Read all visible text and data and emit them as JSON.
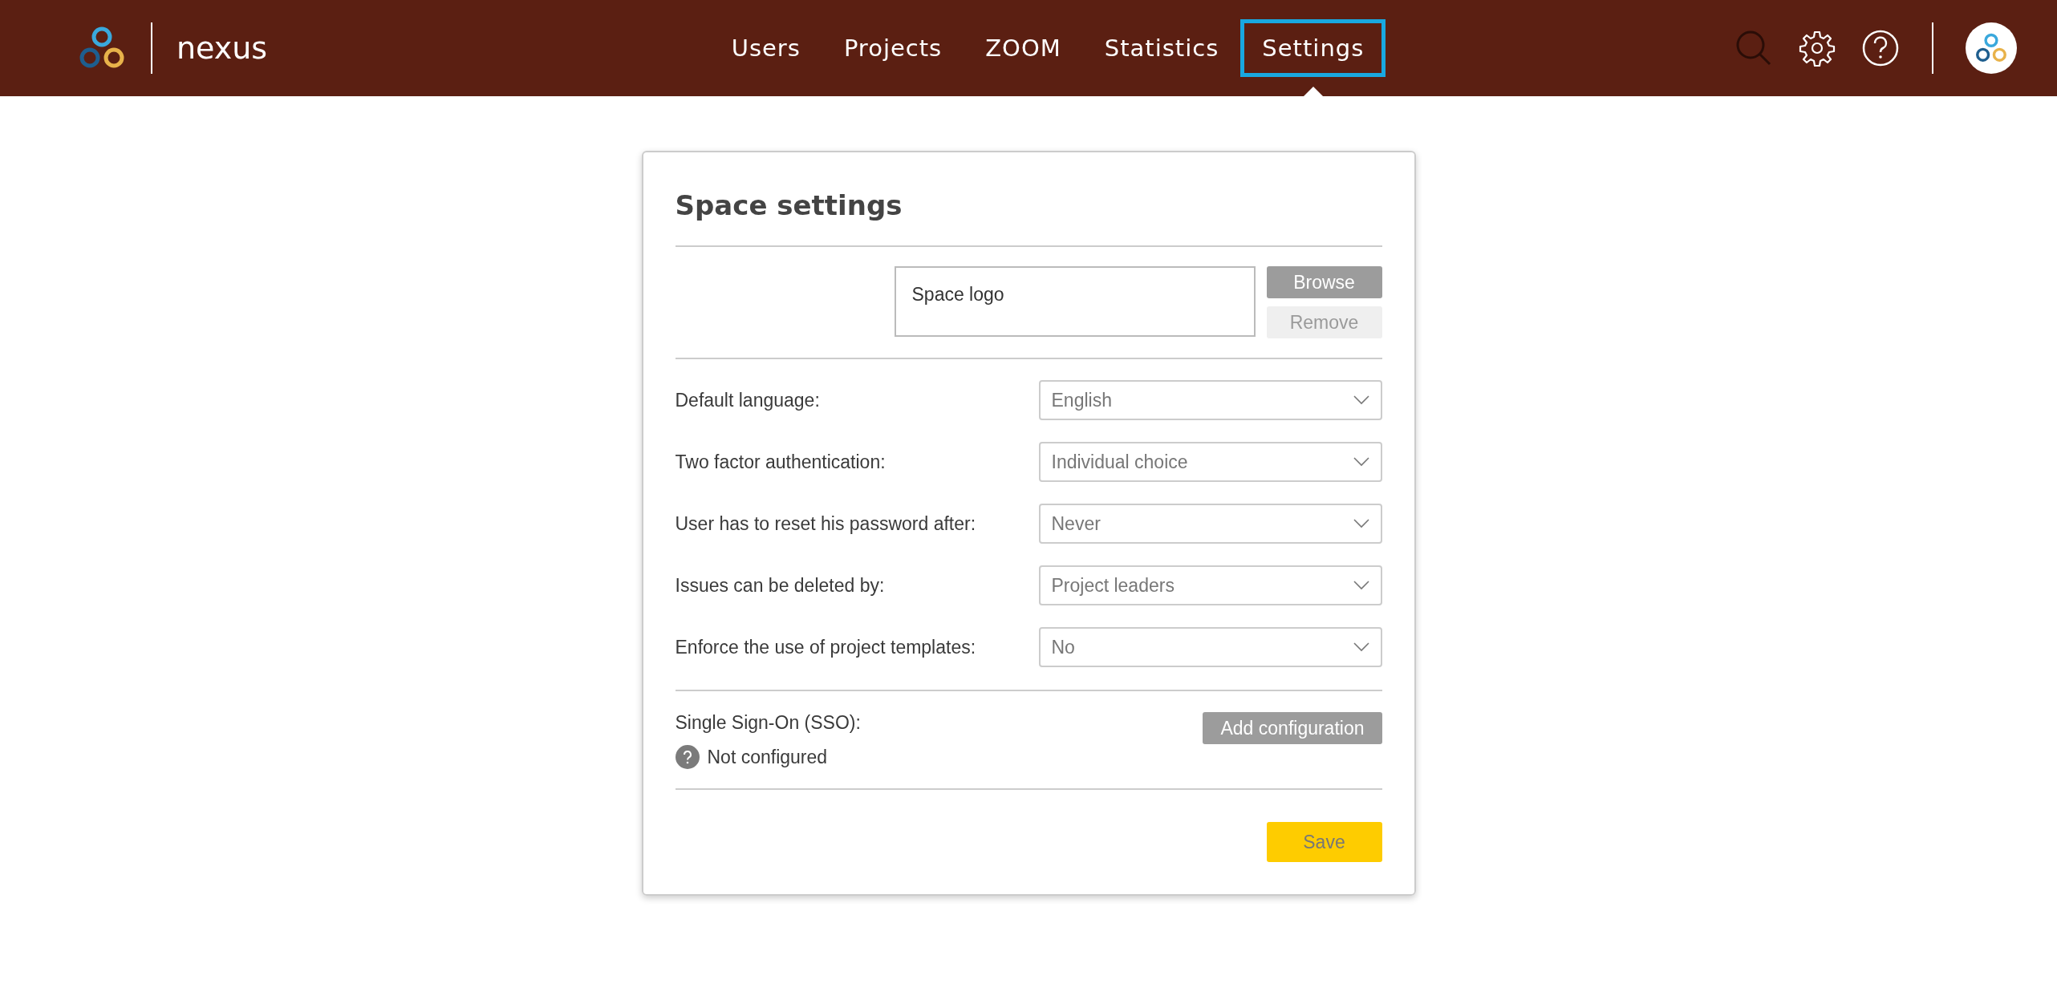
{
  "header": {
    "brand": "nexus",
    "nav": [
      {
        "label": "Users",
        "selected": false
      },
      {
        "label": "Projects",
        "selected": false
      },
      {
        "label": "ZOOM",
        "selected": false
      },
      {
        "label": "Statistics",
        "selected": false
      },
      {
        "label": "Settings",
        "selected": true
      }
    ]
  },
  "card": {
    "title": "Space settings",
    "logo_upload": {
      "placeholder": "Space logo",
      "buttons": [
        {
          "label": "Browse",
          "disabled": false
        },
        {
          "label": "Remove",
          "disabled": true
        }
      ]
    },
    "fields": [
      {
        "label": "Default language:",
        "value": "English"
      },
      {
        "label": "Two factor authentication:",
        "value": "Individual choice"
      },
      {
        "label": "User has to reset his password after:",
        "value": "Never"
      },
      {
        "label": "Issues can be deleted by:",
        "value": "Project leaders"
      },
      {
        "label": "Enforce the use of project templates:",
        "value": "No"
      }
    ],
    "sso": {
      "label": "Single Sign-On (SSO):",
      "status": "Not configured",
      "button": "Add configuration"
    },
    "save": "Save"
  }
}
